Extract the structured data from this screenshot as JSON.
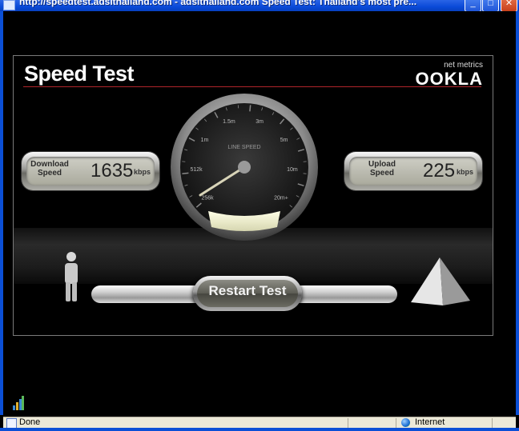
{
  "window": {
    "title": "http://speedtest.adsithailand.com - adsithailand.com Speed Test: Thailand's most pre...",
    "minimize_glyph": "_",
    "maximize_glyph": "□",
    "close_glyph": "✕"
  },
  "speedtest": {
    "title": "Speed Test",
    "brand_small": "net metrics",
    "brand": "OOKLA",
    "download": {
      "label_line1": "Download",
      "label_line2": "Speed",
      "value": "1635",
      "unit": "kbps"
    },
    "upload": {
      "label_line1": "Upload",
      "label_line2": "Speed",
      "value": "225",
      "unit": "kbps"
    },
    "gauge": {
      "label": "LINE SPEED",
      "ticks": [
        "256k",
        "512k",
        "1m",
        "1.5m",
        "3m",
        "5m",
        "10m",
        "20m+"
      ]
    },
    "restart_label": "Restart Test"
  },
  "statusbar": {
    "status": "Done",
    "zone": "Internet"
  },
  "colors": {
    "title_rule": "#b0242a",
    "xp_blue": "#0b4fd6",
    "statusbar": "#ece9d8"
  }
}
